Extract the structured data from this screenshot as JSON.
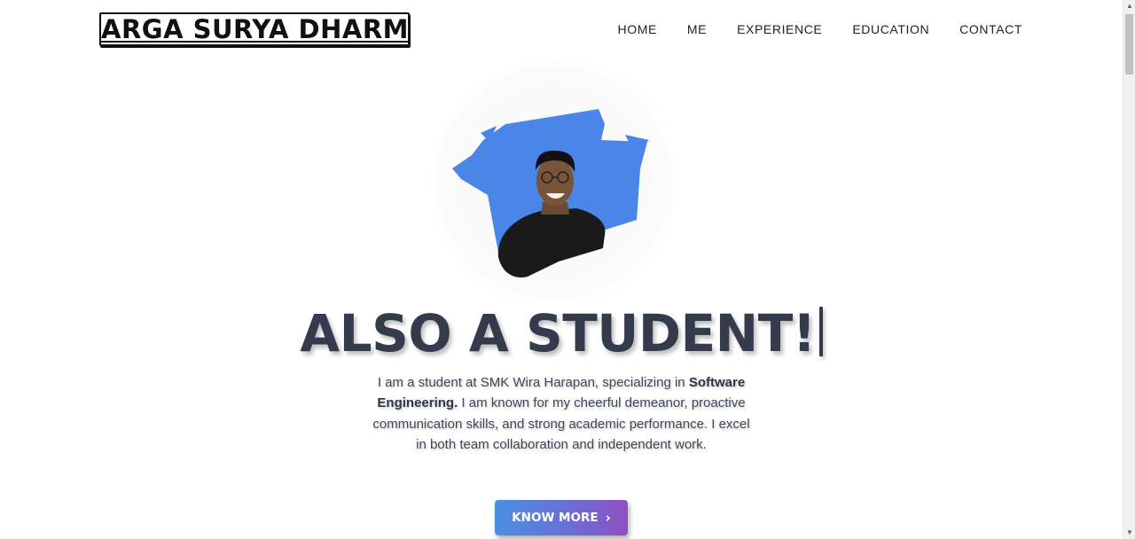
{
  "header": {
    "logo_text": "ARGA SURYA DHARMA",
    "nav": [
      {
        "label": "HOME"
      },
      {
        "label": "ME"
      },
      {
        "label": "EXPERIENCE"
      },
      {
        "label": "EDUCATION"
      },
      {
        "label": "CONTACT"
      }
    ]
  },
  "hero": {
    "avatar_alt": "profile-photo",
    "accent_color": "#4a86e8",
    "headline": "ALSO A STUDENT!",
    "description": {
      "part1": "I am a student at SMK Wira Harapan, specializing in ",
      "bold": "Software Engineering.",
      "part2": " I am known for my cheerful demeanor, proactive communication skills, and strong academic performance. I excel in both team collaboration and independent work."
    },
    "cta_label": "KNOW MORE",
    "cta_icon": "chevron-right-icon"
  }
}
